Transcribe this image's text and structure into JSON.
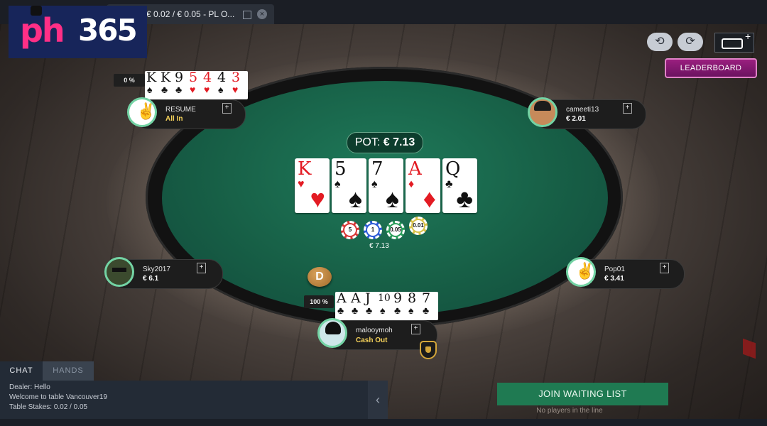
{
  "window": {
    "tab_title": "€ 0.02 / € 0.05 - PL O..."
  },
  "logo": {
    "text_a": "ph",
    "text_b": "365"
  },
  "controls": {
    "rotate_left_icon": "rotate-left",
    "rotate_right_icon": "rotate-right",
    "keyboard_icon": "keyboard",
    "keyboard_plus": "+",
    "leaderboard_label": "LEADERBOARD"
  },
  "table": {
    "pot_label": "POT:",
    "pot_amount": "€ 7.13",
    "board": [
      {
        "rank": "K",
        "suit": "♥",
        "color": "red"
      },
      {
        "rank": "5",
        "suit": "♠",
        "color": "black"
      },
      {
        "rank": "7",
        "suit": "♠",
        "color": "black"
      },
      {
        "rank": "A",
        "suit": "♦",
        "color": "red"
      },
      {
        "rank": "Q",
        "suit": "♣",
        "color": "black"
      }
    ],
    "chips": [
      "5",
      "1",
      "0.05",
      "0.01"
    ],
    "chip_colors": [
      "#d63636",
      "#2d5bd6",
      "#2a9d5a",
      "#d9c24a"
    ],
    "chip_total": "€ 7.13",
    "dealer_label": "D"
  },
  "seats": {
    "resume": {
      "name": "RESUME",
      "status": "All In",
      "equity": "0 %",
      "hand": "KK95443",
      "cards": [
        {
          "r": "K",
          "s": "♠",
          "c": "black"
        },
        {
          "r": "K",
          "s": "♣",
          "c": "black"
        },
        {
          "r": "9",
          "s": "♣",
          "c": "black"
        },
        {
          "r": "5",
          "s": "♥",
          "c": "red"
        },
        {
          "r": "4",
          "s": "♥",
          "c": "red"
        },
        {
          "r": "4",
          "s": "♠",
          "c": "black"
        },
        {
          "r": "3",
          "s": "♥",
          "c": "red"
        }
      ]
    },
    "cameeti": {
      "name": "cameeti13",
      "stack": "€ 2.01"
    },
    "sky": {
      "name": "Sky2017",
      "stack": "€ 6.1"
    },
    "pop": {
      "name": "Pop01",
      "stack": "€ 3.41"
    },
    "hero": {
      "name": "malooymoh",
      "status": "Cash Out",
      "equity": "100 %",
      "cards": [
        {
          "r": "A",
          "s": "♣",
          "c": "black"
        },
        {
          "r": "A",
          "s": "♣",
          "c": "black"
        },
        {
          "r": "J",
          "s": "♣",
          "c": "black"
        },
        {
          "r": "10",
          "s": "♠",
          "c": "black"
        },
        {
          "r": "9",
          "s": "♣",
          "c": "black"
        },
        {
          "r": "8",
          "s": "♠",
          "c": "black"
        },
        {
          "r": "7",
          "s": "♣",
          "c": "black"
        }
      ]
    },
    "addon_symbol": "+"
  },
  "chat": {
    "tab_chat": "CHAT",
    "tab_hands": "HANDS",
    "lines": [
      "Dealer: Hello",
      "Welcome to table Vancouver19",
      "Table Stakes: 0.02 / 0.05"
    ],
    "toggle": "‹"
  },
  "waiting": {
    "join_label": "JOIN WAITING LIST",
    "note": "No players in the line"
  }
}
